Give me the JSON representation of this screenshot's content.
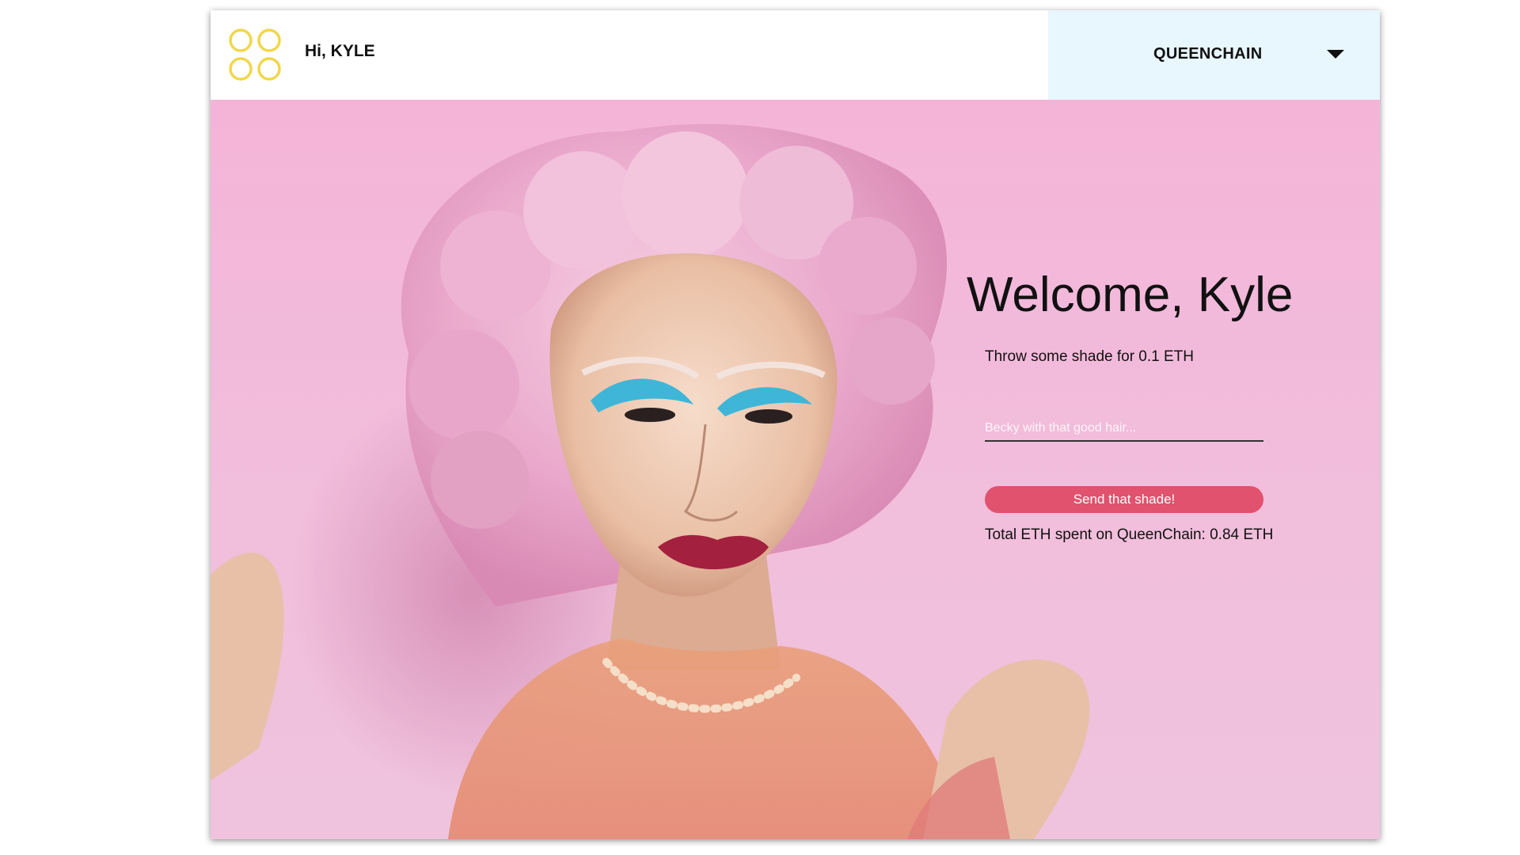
{
  "header": {
    "greeting": "Hi, KYLE",
    "logo_icon": "four-rings-logo-icon",
    "network": {
      "label": "QUEENCHAIN",
      "icon": "chevron-down-icon"
    }
  },
  "main": {
    "welcome_title": "Welcome, Kyle",
    "subtitle": "Throw some shade for 0.1 ETH",
    "shade_input": {
      "placeholder": "Becky with that good hair...",
      "value": ""
    },
    "send_button_label": "Send that shade!",
    "total_text": "Total ETH spent on QueenChain: 0.84 ETH"
  },
  "colors": {
    "logo": "#f2d64b",
    "network_bg": "#e8f6fd",
    "hero_bg": "#f4b4d8",
    "button": "#e0526e"
  }
}
